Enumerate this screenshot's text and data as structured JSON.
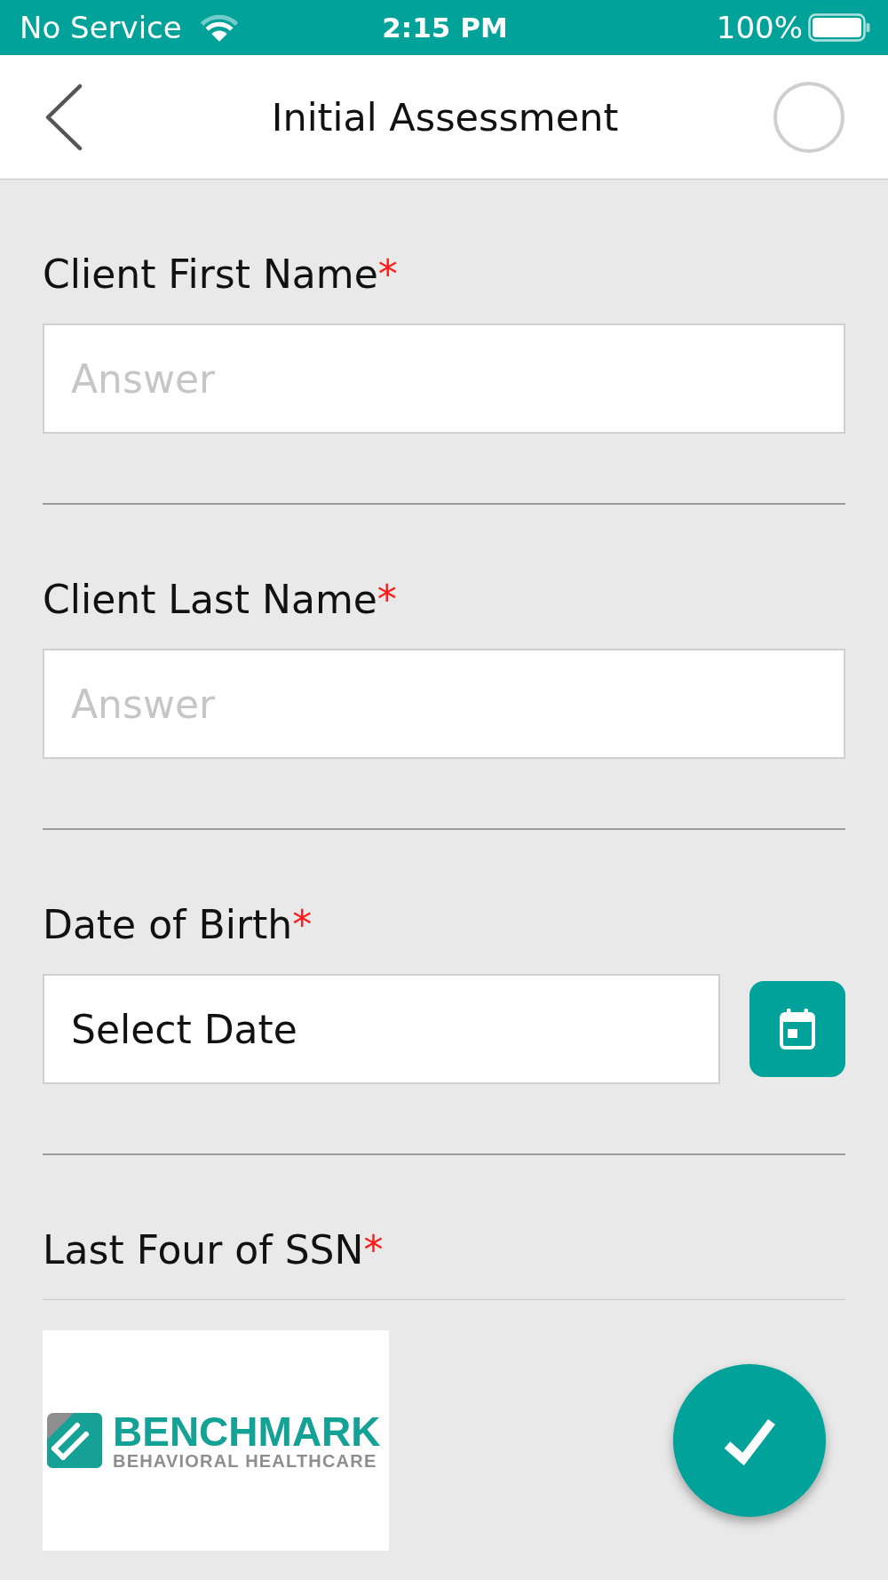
{
  "status_bar": {
    "carrier": "No Service",
    "time": "2:15 PM",
    "battery": "100%"
  },
  "nav_bar": {
    "title": "Initial Assessment"
  },
  "questions": [
    {
      "kind": "text",
      "label": "Client First Name",
      "required_mark": "*",
      "placeholder": "Answer"
    },
    {
      "kind": "text",
      "label": "Client Last Name",
      "required_mark": "*",
      "placeholder": "Answer"
    },
    {
      "kind": "date",
      "label": "Date of Birth",
      "required_mark": "*",
      "value": "Select Date"
    },
    {
      "kind": "label",
      "label": "Last Four of SSN",
      "required_mark": "*"
    }
  ],
  "logo": {
    "name": "BENCHMARK",
    "tagline": "BEHAVIORAL HEALTHCARE"
  }
}
